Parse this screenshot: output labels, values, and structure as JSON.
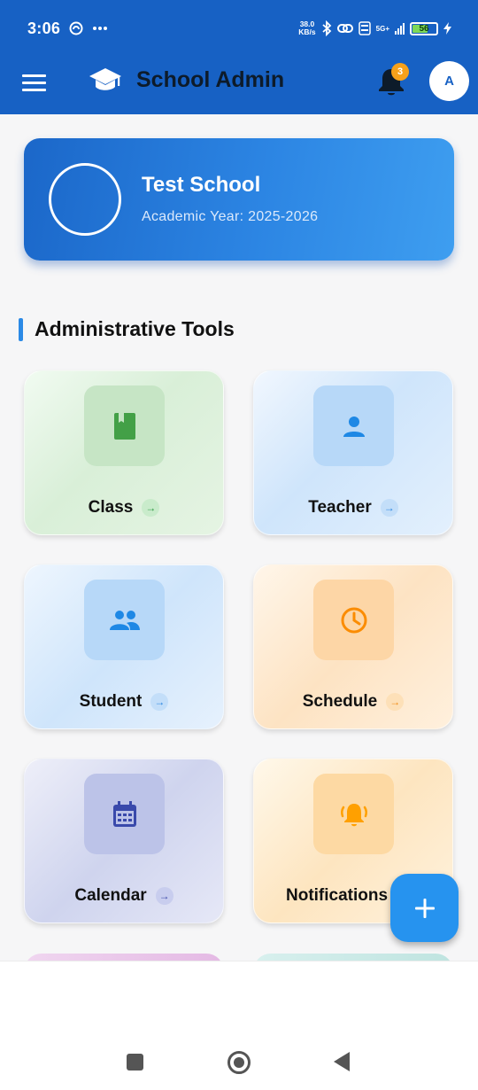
{
  "status_bar": {
    "time": "3:06",
    "net_speed_value": "38.0",
    "net_speed_unit": "KB/s",
    "battery": "56",
    "network_label": "5G+"
  },
  "app_bar": {
    "title": "School Admin",
    "notification_count": "3",
    "avatar_initial": "A"
  },
  "school_card": {
    "name": "Test School",
    "academic_year": "Academic Year: 2025-2026"
  },
  "section": {
    "title": "Administrative Tools"
  },
  "tools": [
    {
      "label": "Class",
      "arrow": "→",
      "icon": "book-icon",
      "color": "#43a047"
    },
    {
      "label": "Teacher",
      "arrow": "→",
      "icon": "person-icon",
      "color": "#1e88e5"
    },
    {
      "label": "Student",
      "arrow": "→",
      "icon": "group-icon",
      "color": "#1e88e5"
    },
    {
      "label": "Schedule",
      "arrow": "→",
      "icon": "clock-icon",
      "color": "#fb8c00"
    },
    {
      "label": "Calendar",
      "arrow": "→",
      "icon": "calendar-icon",
      "color": "#3949ab"
    },
    {
      "label": "Notifications",
      "icon": "bell-ring-icon",
      "color": "#ffa000"
    }
  ],
  "fab": {
    "icon": "plus-icon"
  },
  "colors": {
    "primary": "#1761c4",
    "accent": "#2693ef",
    "badge": "#f7a11a"
  }
}
